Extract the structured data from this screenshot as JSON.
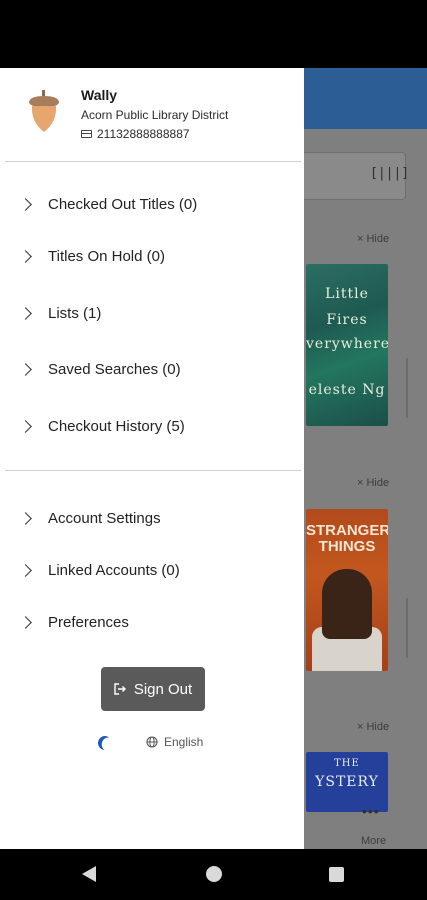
{
  "user": {
    "name": "Wally",
    "library": "Acorn Public Library District",
    "card_number": "21132888888887"
  },
  "menu_primary": [
    {
      "label": "Checked Out Titles (0)"
    },
    {
      "label": "Titles On Hold (0)"
    },
    {
      "label": "Lists (1)"
    },
    {
      "label": "Saved Searches (0)"
    },
    {
      "label": "Checkout History (5)"
    }
  ],
  "menu_secondary": [
    {
      "label": "Account Settings"
    },
    {
      "label": "Linked Accounts (0)"
    },
    {
      "label": "Preferences"
    }
  ],
  "sign_out": {
    "label": "Sign Out"
  },
  "language": {
    "label": "English"
  },
  "background": {
    "hide_label": "× Hide",
    "more_label": "More",
    "covers": [
      {
        "lines": [
          "Little",
          "Fires",
          "verywhere",
          "eleste Ng"
        ]
      },
      {
        "lines": [
          "STRANGER",
          "THINGS"
        ]
      },
      {
        "lines": [
          "THE",
          "YSTERY"
        ]
      }
    ]
  },
  "colors": {
    "header_blue": "#2c5d95",
    "signout_bg": "#5a5a5a",
    "moon": "#1f5bb5"
  }
}
